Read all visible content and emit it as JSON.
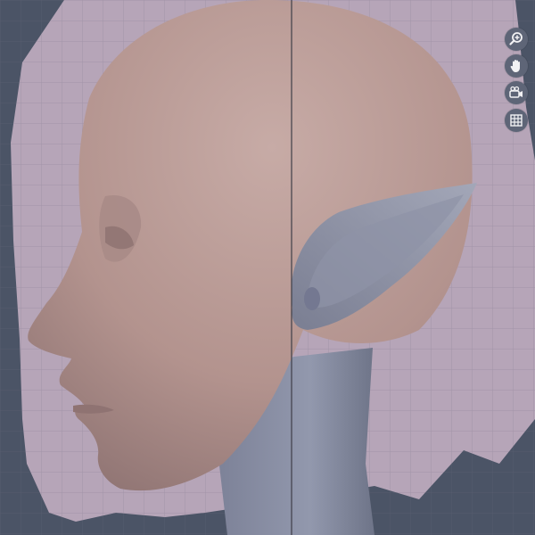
{
  "viewport": {
    "background": "#4b5466",
    "grid_color": "#8a7f93",
    "hair_color": "#b6a5b8",
    "skin_color": "#b89a94",
    "ear_color": "#8a8ea0",
    "neck_color": "#8a90a6",
    "overlay_line_color": "#3f3f48"
  },
  "navigation_gizmo": {
    "axis_color": "#3d7fd0",
    "buttons": [
      {
        "name": "zoom",
        "icon": "zoom-in-icon"
      },
      {
        "name": "pan",
        "icon": "hand-icon"
      },
      {
        "name": "camera",
        "icon": "camera-icon"
      },
      {
        "name": "grid",
        "icon": "grid-icon"
      }
    ]
  }
}
